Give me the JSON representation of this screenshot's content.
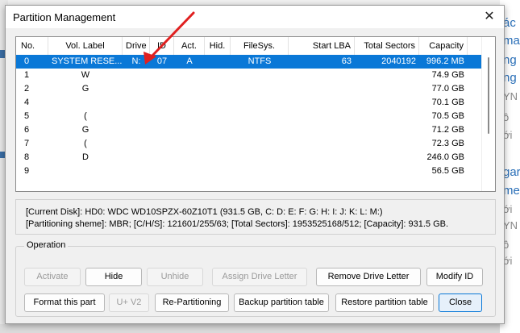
{
  "background": {
    "right_fragments": [
      "ác",
      "ma",
      "ng",
      "ng",
      "YN",
      "ô",
      "ới",
      "gar",
      "me",
      "ới",
      "YN",
      "ô",
      "ới"
    ]
  },
  "dialog": {
    "title": "Partition Management",
    "close_glyph": "✕"
  },
  "table": {
    "headers": {
      "no": "No.",
      "vol": "Vol. Label",
      "drive": "Drive",
      "id": "ID",
      "act": "Act.",
      "hid": "Hid.",
      "fs": "FileSys.",
      "lba": "Start LBA",
      "total": "Total Sectors",
      "capacity": "Capacity"
    },
    "rows": [
      {
        "no": "0",
        "vol": "SYSTEM RESE...",
        "drive": "N:",
        "id": "07",
        "act": "A",
        "hid": "",
        "fs": "NTFS",
        "lba": "63",
        "total": "2040192",
        "capacity": "996.2 MB"
      },
      {
        "no": "1",
        "vol": "W",
        "drive": "",
        "id": "",
        "act": "",
        "hid": "",
        "fs": "",
        "lba": "",
        "total": "",
        "capacity": "74.9 GB"
      },
      {
        "no": "2",
        "vol": "G",
        "drive": "",
        "id": "",
        "act": "",
        "hid": "",
        "fs": "",
        "lba": "",
        "total": "",
        "capacity": "77.0 GB"
      },
      {
        "no": "4",
        "vol": "",
        "drive": "",
        "id": "",
        "act": "",
        "hid": "",
        "fs": "",
        "lba": "",
        "total": "",
        "capacity": "70.1 GB"
      },
      {
        "no": "5",
        "vol": "(",
        "drive": "",
        "id": "",
        "act": "",
        "hid": "",
        "fs": "",
        "lba": "",
        "total": "",
        "capacity": "70.5 GB"
      },
      {
        "no": "6",
        "vol": "G",
        "drive": "",
        "id": "",
        "act": "",
        "hid": "",
        "fs": "",
        "lba": "",
        "total": "",
        "capacity": "71.2 GB"
      },
      {
        "no": "7",
        "vol": "(",
        "drive": "",
        "id": "",
        "act": "",
        "hid": "",
        "fs": "",
        "lba": "",
        "total": "",
        "capacity": "72.3 GB"
      },
      {
        "no": "8",
        "vol": "D",
        "drive": "",
        "id": "",
        "act": "",
        "hid": "",
        "fs": "",
        "lba": "",
        "total": "",
        "capacity": "246.0 GB"
      },
      {
        "no": "9",
        "vol": "",
        "drive": "",
        "id": "",
        "act": "",
        "hid": "",
        "fs": "",
        "lba": "",
        "total": "",
        "capacity": "56.5 GB"
      }
    ],
    "selected_row": 0
  },
  "info": {
    "line1": "[Current Disk]:   HD0: WDC WD10SPZX-60Z10T1 (931.5 GB, C: D: E: F: G: H: I: J: K: L: M:)",
    "line2": "[Partitioning sheme]:    MBR;      [C/H/S]: 121601/255/63; [Total Sectors]: 1953525168/512; [Capacity]: 931.5 GB."
  },
  "operation": {
    "title": "Operation",
    "buttons_row1": {
      "activate": "Activate",
      "hide": "Hide",
      "unhide": "Unhide",
      "assign": "Assign Drive Letter",
      "remove": "Remove Drive Letter",
      "modify": "Modify ID"
    },
    "buttons_row2": {
      "format": "Format this part",
      "uv2": "U+ V2",
      "repart": "Re-Partitioning",
      "backup": "Backup partition table",
      "restore": "Restore partition table",
      "close": "Close"
    }
  },
  "colors": {
    "selection": "#0a78d7",
    "annotation_arrow": "#e02020"
  }
}
